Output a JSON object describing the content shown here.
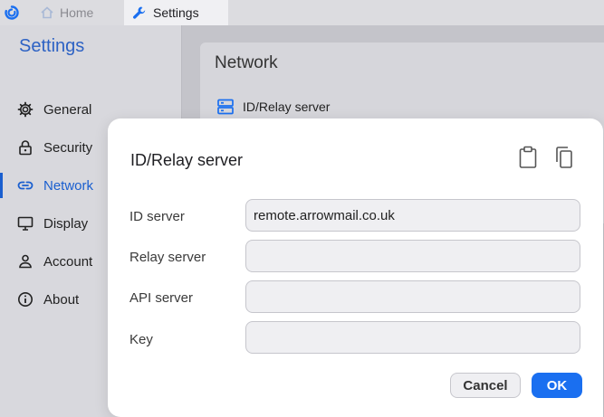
{
  "titlebar": {
    "app_icon": "rustdesk-logo",
    "tabs": [
      {
        "label": "Home",
        "icon": "home-icon"
      },
      {
        "label": "Settings",
        "icon": "wrench-icon"
      }
    ]
  },
  "sidebar": {
    "title": "Settings",
    "items": [
      {
        "label": "General",
        "icon": "gear-icon"
      },
      {
        "label": "Security",
        "icon": "lock-icon"
      },
      {
        "label": "Network",
        "icon": "link-icon",
        "active": true
      },
      {
        "label": "Display",
        "icon": "monitor-icon"
      },
      {
        "label": "Account",
        "icon": "person-icon"
      },
      {
        "label": "About",
        "icon": "info-icon"
      }
    ]
  },
  "main": {
    "section_title": "Network",
    "row_label": "ID/Relay server"
  },
  "dialog": {
    "title": "ID/Relay server",
    "fields": [
      {
        "label": "ID server",
        "value": "remote.arrowmail.co.uk"
      },
      {
        "label": "Relay server",
        "value": ""
      },
      {
        "label": "API server",
        "value": ""
      },
      {
        "label": "Key",
        "value": ""
      }
    ],
    "cancel_label": "Cancel",
    "ok_label": "OK"
  },
  "colors": {
    "accent": "#1a6ff0",
    "sidebar_title": "#2d62c4",
    "active_nav": "#1a5fcf"
  }
}
